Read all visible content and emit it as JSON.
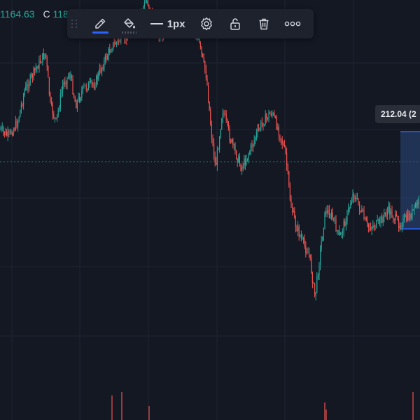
{
  "ohlc": {
    "close_value": "1164.63",
    "label_c": "C",
    "label_c_value": "118"
  },
  "toolbar": {
    "tools": [
      {
        "name": "pencil-icon",
        "active": true
      },
      {
        "name": "fill-bucket-icon"
      },
      {
        "name": "line-width"
      },
      {
        "name": "gear-icon"
      },
      {
        "name": "unlock-icon"
      },
      {
        "name": "trash-icon"
      },
      {
        "name": "more-icon"
      }
    ],
    "line_width_label": "1px"
  },
  "measure": {
    "price_label": "212.04 (2"
  },
  "colors": {
    "background": "#141823",
    "up": "#26a69a",
    "down": "#ef5350",
    "grid": "#1f2433",
    "accent": "#2962ff",
    "dotted_line": "#26a69a",
    "measure_fill": "#2a4a80"
  }
}
